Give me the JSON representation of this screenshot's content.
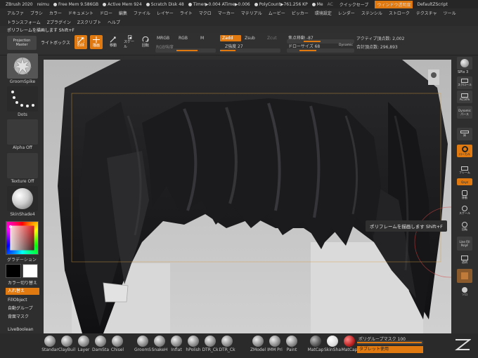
{
  "title_bar": {
    "app": "ZBrush 2020",
    "user": "reimu",
    "items": [
      "Free Mem 9.586GB",
      "Active Mem 924",
      "Scratch Disk 48",
      "Timer▶0.004 ATime▶0.006",
      "PolyCount▶761.256 KP",
      "Me"
    ],
    "ac": "AC",
    "quick_save": "クイックセーブ",
    "window_trans": "ウィンドウ透明度",
    "script": "DefaultZScript"
  },
  "menu": [
    "アルファ",
    "ブラシ",
    "カラー",
    "ドキュメント",
    "ドロー",
    "編集",
    "ファイル",
    "レイヤー",
    "ライト",
    "マクロ",
    "マーカー",
    "マテリアル",
    "ムービー",
    "ピッカー",
    "環境設定",
    "レンダー",
    "ステンシル",
    "ストローク",
    "テクスチャ",
    "ツール"
  ],
  "menu2": [
    "トランスフォーム",
    "Zプラグイン",
    "Zスクリプト",
    "ヘルプ"
  ],
  "hint": "ポリフレームを描画します Shift+F",
  "toolbar": {
    "projection": "Projection",
    "master": "Master",
    "lightbox": "ライトボックス",
    "edit": "Edit",
    "draw": "描画",
    "move": "移動",
    "scale": "スケール",
    "rotate": "回転",
    "mrgb": "MRGB",
    "rgb": "RGB",
    "m": "M",
    "rgb_intensity": "RGB強度",
    "zadd": "Zadd",
    "zsub": "Zsub",
    "zcut": "Zcut",
    "z_intensity": "Z強度 27",
    "focal_shift": "焦点移動 -87",
    "draw_size": "ドローサイズ 68",
    "dynamic": "Dynamic",
    "active_points": "アクティブ頂点数: 2,002",
    "total_points": "合計頂点数: 296,893"
  },
  "left_panel": {
    "brush_label": "GroomSpike",
    "stroke_label": "Dots",
    "alpha_label": "Alpha Off",
    "texture_label": "Texture Off",
    "material_label": "SkinShade4",
    "gradient": "グラデーション",
    "color_switch": "カラー切り替え",
    "swap": "入れ替え",
    "fill_object": "FillObject",
    "auto_group": "自動グループ",
    "back_mask": "背面マスク",
    "live_boolean": "LiveBoolean"
  },
  "right_panel": {
    "bpr": "BPR",
    "spix": "SPix 3",
    "scroll": "スクロール",
    "zoom": "ズーム",
    "ac50": "AC50%",
    "dynamic": "Dynamic",
    "persp": "パース",
    "floor": "床",
    "local": "ローカル",
    "frame": "フレーム",
    "move": "移動",
    "zoom3d": "スケール",
    "rotate": "回転",
    "line_fill": "Line Fill",
    "polyf": "PolyF",
    "transp": "透明",
    "solo": "ソロ",
    "xyz": "Qxyz"
  },
  "tooltip": "ポリフレームを描画します Shift+F",
  "bottom_bar": {
    "brushes": [
      "Standar",
      "ClayBuil",
      "Layer",
      "DamSta",
      "Chisel",
      "GroomS",
      "SnakeH",
      "Inflat",
      "hPolish",
      "DTR_Ck",
      "DTR_Ck",
      "ZModel",
      "IMM Pri",
      "Paint",
      "MatCap",
      "SkinSha",
      "MatCap"
    ],
    "polygroup_mask": "ポリグループマスク 100",
    "tablet": "タブレット使用"
  },
  "colors": {
    "accent": "#e07a10",
    "hair": "#1c1c1e",
    "background": "#c4c4c4"
  }
}
